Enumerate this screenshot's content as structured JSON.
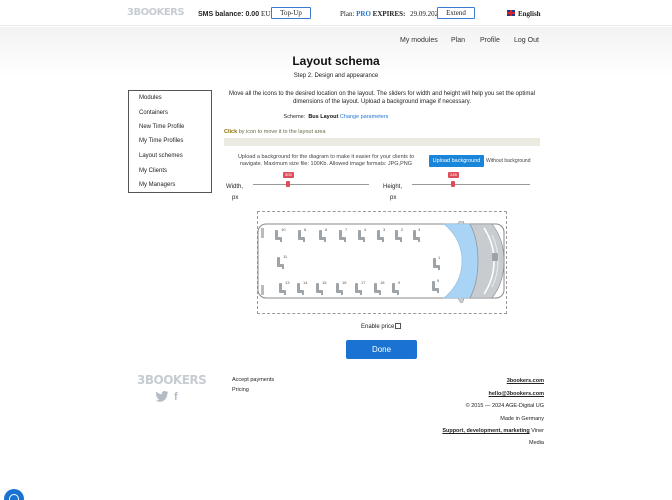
{
  "header": {
    "logo": "3BOOKERS",
    "sms_label": "SMS balance:",
    "sms_value": "0.00",
    "sms_currency": "EUR",
    "topup_label": "Top-Up",
    "plan_label": "Plan:",
    "plan_name": "PRO",
    "expires_label": "EXPIRES:",
    "expires_date": "29.09.2025",
    "extend_label": "Extend",
    "language": "English"
  },
  "nav": [
    "My modules",
    "Plan",
    "Profile",
    "Log Out"
  ],
  "page": {
    "title": "Layout schema",
    "step": "Step 2. Design and appearance",
    "description": "Move all the icons to the desired location on the layout. The sliders for width and height will help you set the optimal dimensions of the layout. Upload a background image if necessary.",
    "scheme_label": "Scheme:",
    "scheme_name": "Bus Layout",
    "change_params": "Change parameters",
    "hint_bold": "Click",
    "hint_rest": "by icon to move it to the layout area",
    "upload_text": "Upload a background for the diagram to make it easier for your clients to navigate. Maximum size file: 100Kb. Allowed image formats: JPG,PNG",
    "upload_button": "Upload background",
    "without_background": "Without background",
    "width_label": "Width,",
    "width_unit": "px",
    "width_value": "500",
    "height_label": "Height,",
    "height_unit": "px",
    "height_value": "245",
    "enable_price": "Enable price",
    "done": "Done"
  },
  "sidebar": {
    "items": [
      "Modules",
      "Containers",
      "New Time Profile",
      "My Time Profiles",
      "Layout schemes",
      "My Clients",
      "My Managers"
    ]
  },
  "seats": {
    "top_row": [
      "10",
      "8",
      "6",
      "7",
      "4",
      "3",
      "2"
    ],
    "middle_left": "11",
    "middle_right": "1",
    "bottom_row": [
      "13",
      "14",
      "15",
      "16",
      "17",
      "18",
      "9"
    ]
  },
  "footer": {
    "logo": "3BOOKERS",
    "links_left": [
      "Accept payments",
      "Pricing"
    ],
    "site": "3bookers.com",
    "email": "hello@3bookers.com",
    "copyright": "© 2015 — 2024 AGE-Digital UG",
    "made_in": "Made in Germany",
    "support": "Support, development, marketing",
    "support_by": "Viner",
    "support_by2": "Media"
  },
  "colors": {
    "accent": "#1a73d2",
    "slider": "#e04d5a",
    "windshield": "#a9d4f5"
  }
}
